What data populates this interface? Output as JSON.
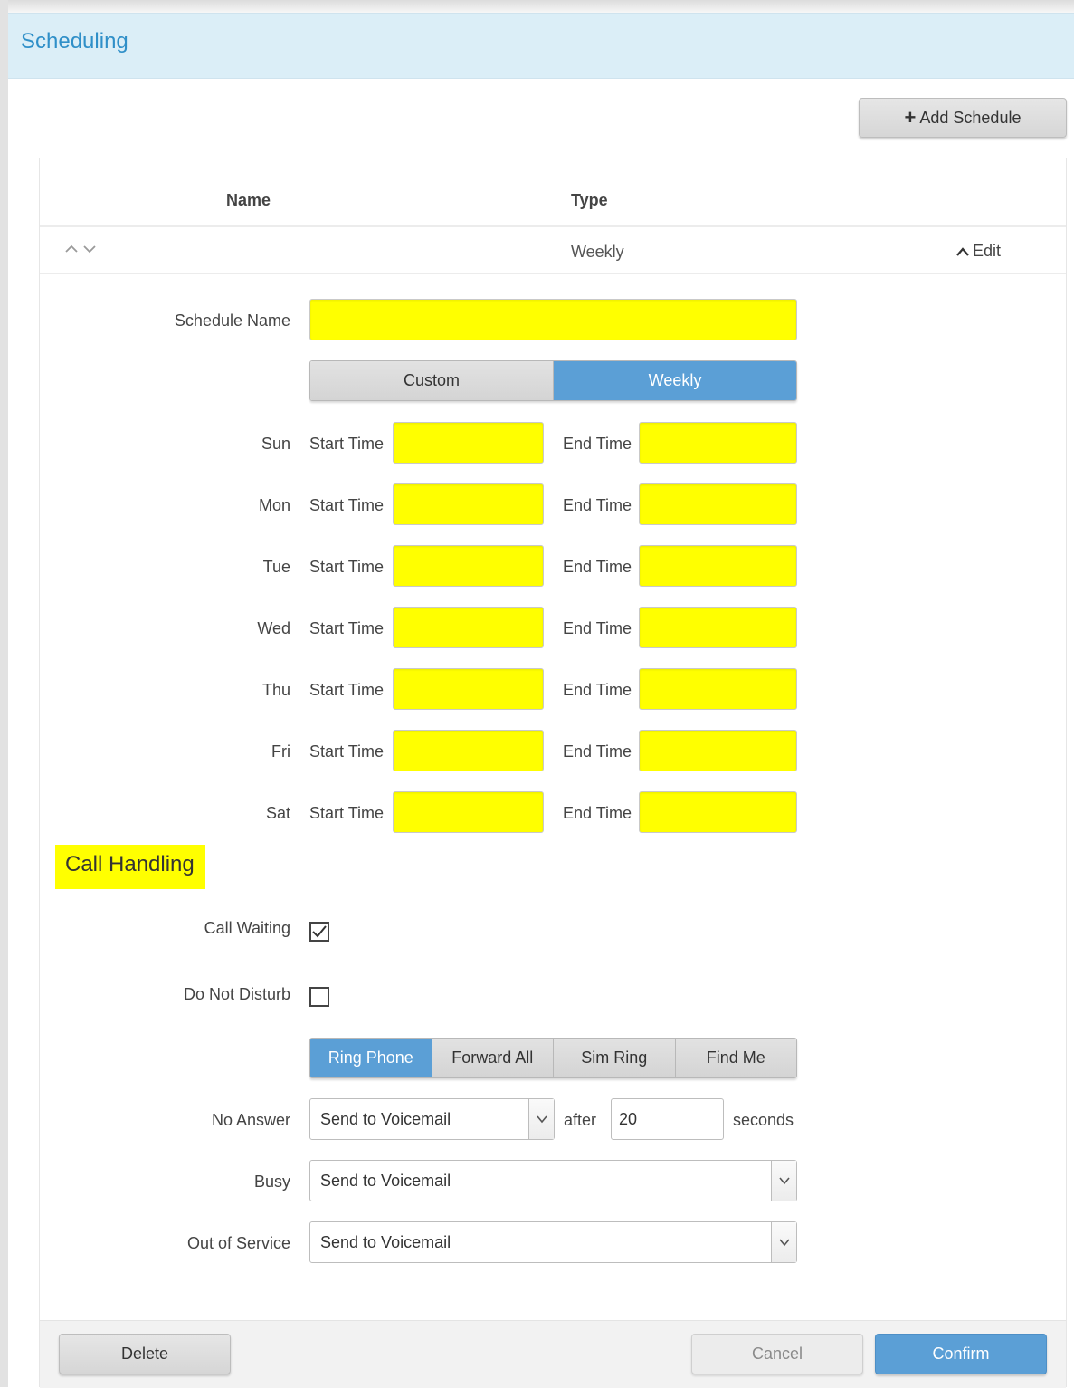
{
  "header": {
    "title": "Scheduling"
  },
  "toolbar": {
    "add_label": "Add Schedule"
  },
  "table": {
    "columns": {
      "name": "Name",
      "type": "Type"
    },
    "row": {
      "type": "Weekly",
      "edit_label": "Edit"
    }
  },
  "form": {
    "schedule_name_label": "Schedule Name",
    "schedule_name_value": "",
    "type_options": [
      "Custom",
      "Weekly"
    ],
    "type_selected": "Weekly",
    "start_label": "Start Time",
    "end_label": "End Time",
    "days": [
      {
        "day": "Sun",
        "start": "",
        "end": ""
      },
      {
        "day": "Mon",
        "start": "",
        "end": ""
      },
      {
        "day": "Tue",
        "start": "",
        "end": ""
      },
      {
        "day": "Wed",
        "start": "",
        "end": ""
      },
      {
        "day": "Thu",
        "start": "",
        "end": ""
      },
      {
        "day": "Fri",
        "start": "",
        "end": ""
      },
      {
        "day": "Sat",
        "start": "",
        "end": ""
      }
    ]
  },
  "call_handling": {
    "heading": "Call Handling",
    "call_waiting_label": "Call Waiting",
    "call_waiting_checked": true,
    "dnd_label": "Do Not Disturb",
    "dnd_checked": false,
    "modes": [
      "Ring Phone",
      "Forward All",
      "Sim Ring",
      "Find Me"
    ],
    "mode_selected": "Ring Phone",
    "no_answer_label": "No Answer",
    "no_answer_value": "Send to Voicemail",
    "after_label": "after",
    "seconds_value": "20",
    "seconds_label": "seconds",
    "busy_label": "Busy",
    "busy_value": "Send to Voicemail",
    "oos_label": "Out of Service",
    "oos_value": "Send to Voicemail"
  },
  "footer": {
    "delete_label": "Delete",
    "cancel_label": "Cancel",
    "confirm_label": "Confirm"
  },
  "colors": {
    "accent": "#5b9fd6",
    "title_blue": "#2f8fc8",
    "header_bg": "#dbeef7",
    "highlight": "#ffff00"
  }
}
